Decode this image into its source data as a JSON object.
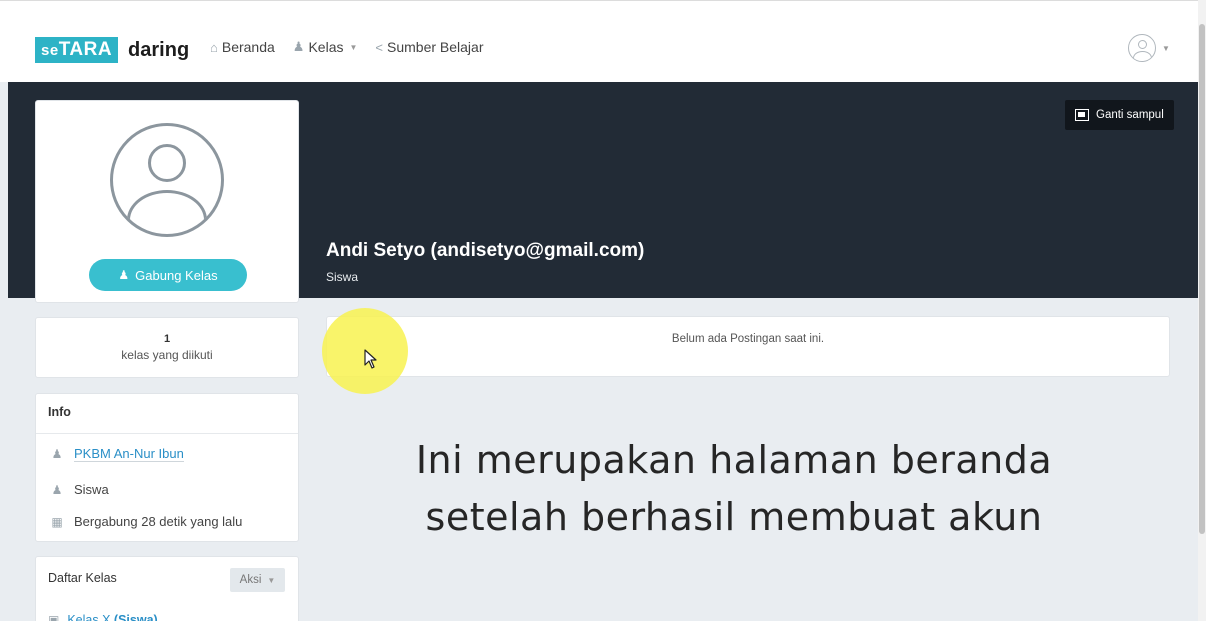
{
  "topnav": {
    "logo_prefix": "se",
    "logo_box": "TARA",
    "logo_rest": "daring",
    "items": [
      {
        "label": "Beranda",
        "icon": "home-icon"
      },
      {
        "label": "Kelas",
        "icon": "users-icon"
      },
      {
        "label": "Sumber Belajar",
        "icon": "share-icon"
      }
    ]
  },
  "banner": {
    "cover_button": "Ganti sampul",
    "name": "Andi Setyo (andisetyo@gmail.com)",
    "role": "Siswa"
  },
  "profile_card": {
    "join_button": "Gabung Kelas"
  },
  "stats": {
    "count": "1",
    "label": "kelas yang diikuti"
  },
  "info": {
    "title": "Info",
    "school": "PKBM An-Nur Ibun",
    "role": "Siswa",
    "joined": "Bergabung 28 detik yang lalu"
  },
  "classes": {
    "title": "Daftar Kelas",
    "action_button": "Aksi",
    "items": [
      {
        "name": "Kelas X",
        "role": "(Siswa)"
      }
    ]
  },
  "posts": {
    "empty_message": "Belum ada Postingan saat ini."
  },
  "overlay": {
    "line1": "Ini merupakan halaman beranda",
    "line2": "setelah berhasil membuat akun"
  },
  "colors": {
    "brand": "#2db3c6",
    "banner": "#222b36",
    "join_button": "#39bfcf",
    "link": "#2a8fc7",
    "highlight": "#f8f250"
  }
}
